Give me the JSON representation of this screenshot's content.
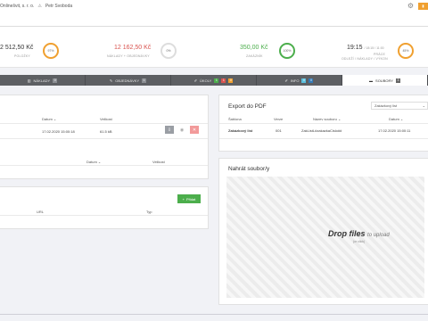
{
  "topbar": {
    "company": "Onlinešvit, s. r. o.",
    "user": "Petr Svoboda"
  },
  "stats": {
    "s1_value": "2 512,50 Kč",
    "s1_label": "POLOŽKY",
    "s1_gauge": "97%",
    "s2_value": "12 162,50 Kč",
    "s2_label": "NÁKLADY + OBJEDNÁVKY",
    "s2_gauge": "0%",
    "s3_value": "350,00 Kč",
    "s3_label": "ZAKÁZNÍK",
    "s3_gauge": "100%",
    "s4_value": "19:15",
    "s4_value_suffix": "/ 18:15 / 11:00",
    "s4_label_main": "PRÁCE",
    "s4_label_sub": "ODLEŽÍ / NÁKLADY / VÝKON",
    "s4_gauge": "45%"
  },
  "tabs": [
    {
      "label": "NÁKLADY",
      "badge": "0"
    },
    {
      "label": "OBJEDNÁVKY",
      "badge": "1"
    },
    {
      "label": "ÚKOLY",
      "badges": [
        "1",
        "1",
        "0"
      ]
    },
    {
      "label": "INFO",
      "badges": [
        "0",
        "0"
      ]
    },
    {
      "label": "SOUBORY",
      "badge": "3"
    }
  ],
  "files_panel": {
    "col_date": "Datum",
    "col_size": "Velikost",
    "row_date": "17.02.2020 15:00:18",
    "row_size": "61.5 kB",
    "col2_date": "Datum",
    "col2_size": "Velikost"
  },
  "links_panel": {
    "add_label": "Přidat",
    "col_url": "URL",
    "col_type": "Typ"
  },
  "export": {
    "title": "Export do PDF",
    "select_value": "Zakázkový list",
    "col_template": "Šablona",
    "col_version": "Verze",
    "col_filename": "Název souboru",
    "col_date": "Datum",
    "row_template": "Zakázkový list",
    "row_version": "001",
    "row_filename": "ZakListL#zakazkaCislo##",
    "row_date": "17.02.2020 15:00:11"
  },
  "upload": {
    "title": "Nahrát soubor/y",
    "drop_bold": "Drop files",
    "drop_rest": "to upload",
    "drop_sub": "(or click)"
  },
  "colors": {
    "green": "#4cae4c",
    "orange": "#f0a030",
    "tabbar": "#5d5f63"
  }
}
